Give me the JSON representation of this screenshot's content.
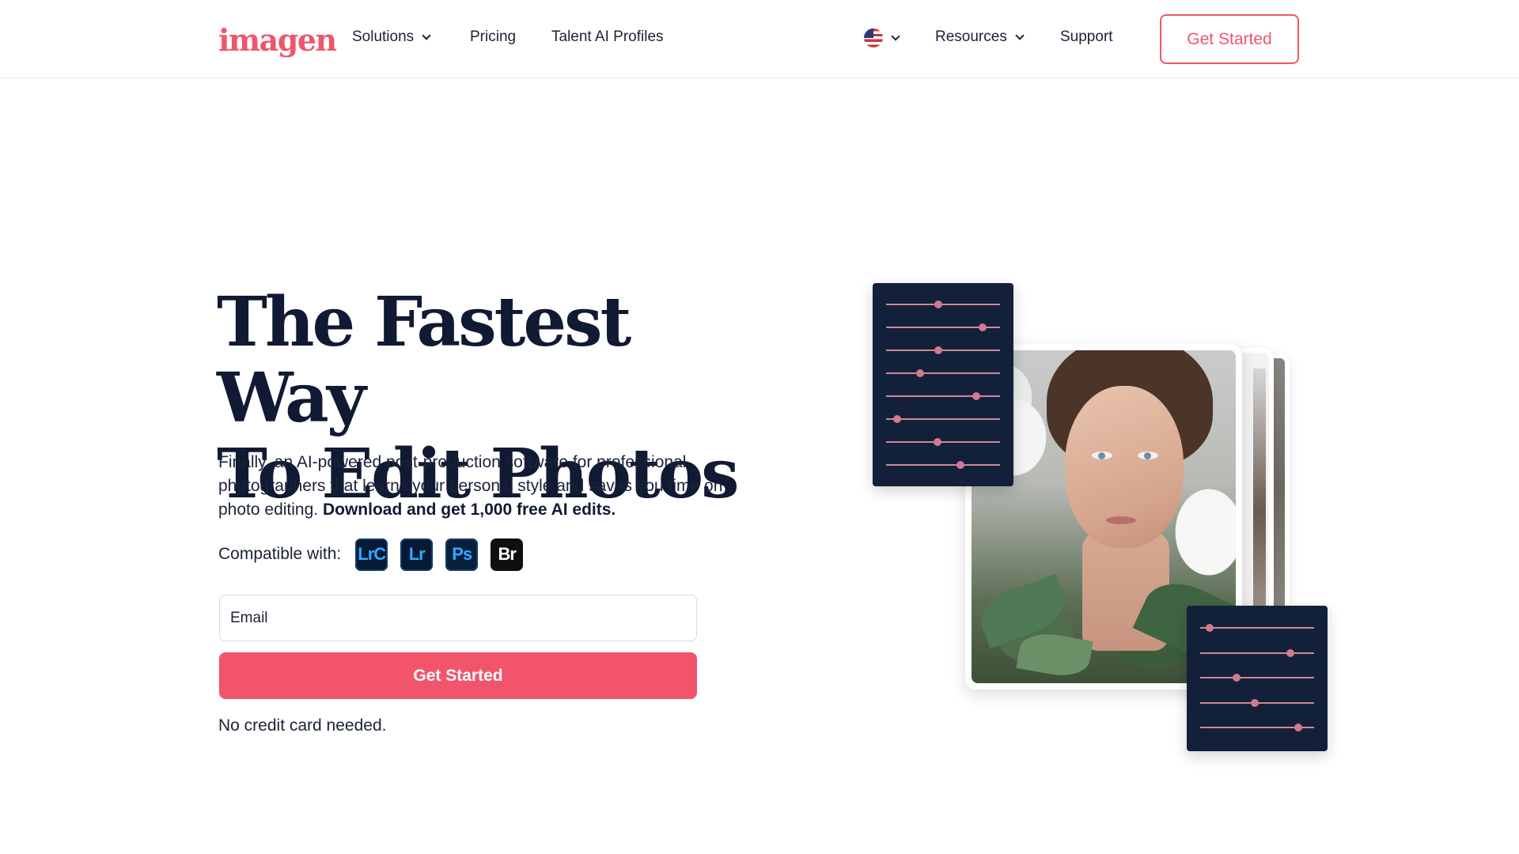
{
  "header": {
    "logo": "imagen",
    "nav": {
      "solutions": "Solutions",
      "pricing": "Pricing",
      "talent": "Talent AI Profiles",
      "resources": "Resources",
      "support": "Support"
    },
    "cta": "Get Started",
    "language_icon": "us-flag-icon"
  },
  "hero": {
    "title_line1": "The Fastest Way",
    "title_line2": "To Edit Photos",
    "description": "Finally, an AI-powered post-production software for professional photographers that learns your personal style and saves you time on photo editing.",
    "description_bold": "Download and get 1,000 free AI edits.",
    "compatible_label": "Compatible with:",
    "apps": [
      "LrC",
      "Lr",
      "Ps",
      "Br"
    ],
    "email_placeholder": "Email",
    "cta": "Get Started",
    "note": "No credit card needed."
  },
  "illustration": {
    "top_panel_slider_levels": [
      0.46,
      0.85,
      0.46,
      0.3,
      0.79,
      0.1,
      0.45,
      0.65
    ],
    "bottom_panel_slider_levels": [
      0.08,
      0.79,
      0.32,
      0.48,
      0.86
    ]
  },
  "colors": {
    "brand": "#f0556e",
    "navy": "#101a33",
    "panel": "#13203a"
  }
}
